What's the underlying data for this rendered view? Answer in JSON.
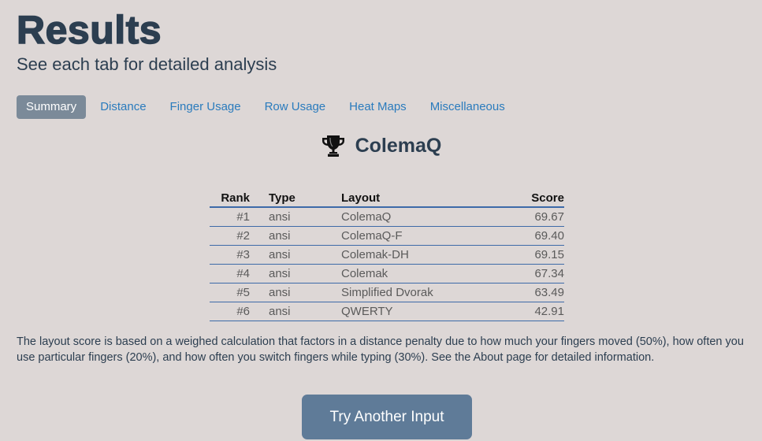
{
  "header": {
    "title": "Results",
    "subtitle": "See each tab for detailed analysis"
  },
  "tabs": [
    {
      "label": "Summary",
      "active": true
    },
    {
      "label": "Distance",
      "active": false
    },
    {
      "label": "Finger Usage",
      "active": false
    },
    {
      "label": "Row Usage",
      "active": false
    },
    {
      "label": "Heat Maps",
      "active": false
    },
    {
      "label": "Miscellaneous",
      "active": false
    }
  ],
  "winner": {
    "icon": "trophy-icon",
    "name": "ColemaQ"
  },
  "table": {
    "headers": [
      "Rank",
      "Type",
      "Layout",
      "Score"
    ],
    "rows": [
      {
        "rank": "#1",
        "type": "ansi",
        "layout": "ColemaQ",
        "score": "69.67"
      },
      {
        "rank": "#2",
        "type": "ansi",
        "layout": "ColemaQ-F",
        "score": "69.40"
      },
      {
        "rank": "#3",
        "type": "ansi",
        "layout": "Colemak-DH",
        "score": "69.15"
      },
      {
        "rank": "#4",
        "type": "ansi",
        "layout": "Colemak",
        "score": "67.34"
      },
      {
        "rank": "#5",
        "type": "ansi",
        "layout": "Simplified Dvorak",
        "score": "63.49"
      },
      {
        "rank": "#6",
        "type": "ansi",
        "layout": "QWERTY",
        "score": "42.91"
      }
    ]
  },
  "description": "The layout score is based on a weighed calculation that factors in a distance penalty due to how much your fingers moved (50%), how often you use particular fingers (20%), and how often you switch fingers while typing (30%). See the About page for detailed information.",
  "cta_label": "Try Another Input",
  "colors": {
    "background": "#ddd7d6",
    "heading": "#2c3e50",
    "link": "#2a7bbd",
    "active_tab": "#7b8a99",
    "table_rule": "#3d6aa8",
    "button": "#5f7b98"
  }
}
